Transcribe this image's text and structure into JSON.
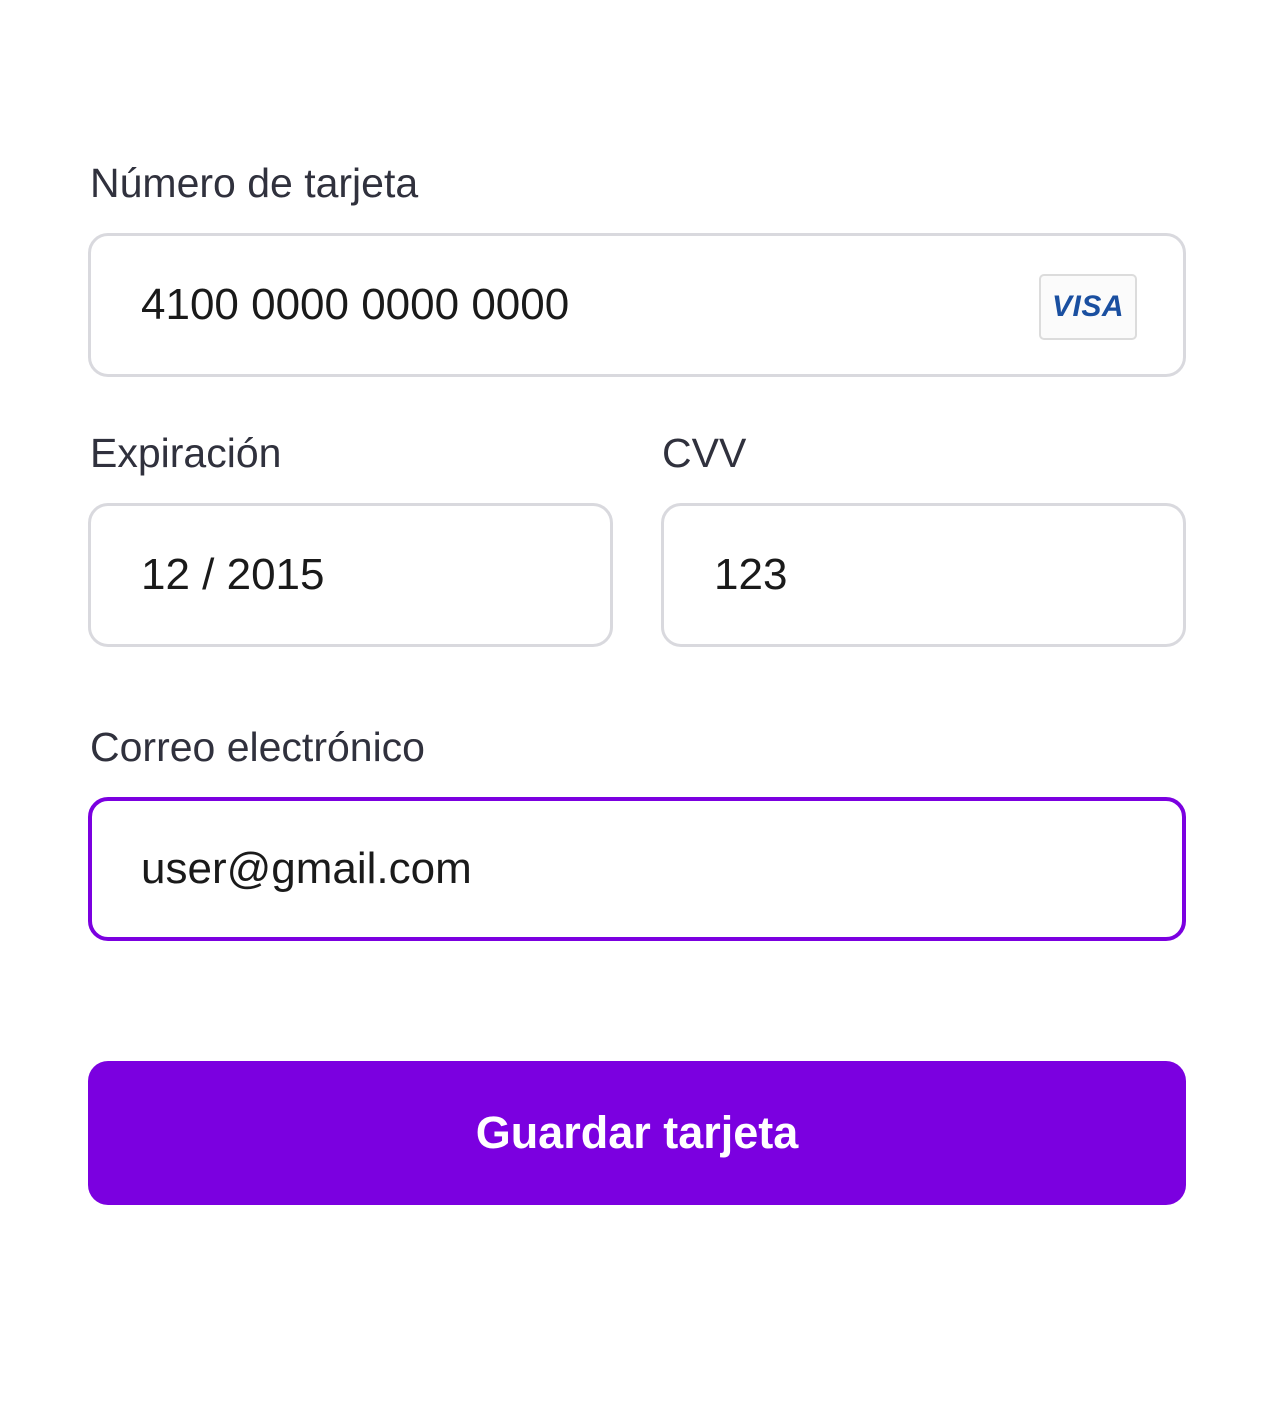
{
  "form": {
    "card_number": {
      "label": "Número de tarjeta",
      "value": "4100 0000 0000 0000",
      "brand": "VISA"
    },
    "expiration": {
      "label": "Expiración",
      "value": "12 / 2015"
    },
    "cvv": {
      "label": "CVV",
      "value": "123"
    },
    "email": {
      "label": "Correo electrónico",
      "value": "user@gmail.com",
      "focused": true
    },
    "submit_label": "Guardar tarjeta"
  },
  "colors": {
    "accent": "#7b00e0",
    "border": "#d9d9de",
    "label_text": "#30313d",
    "value_text": "#1a1a1a",
    "brand": "#1a4fa0"
  },
  "icons": {
    "card_brand": "visa-logo-icon"
  }
}
